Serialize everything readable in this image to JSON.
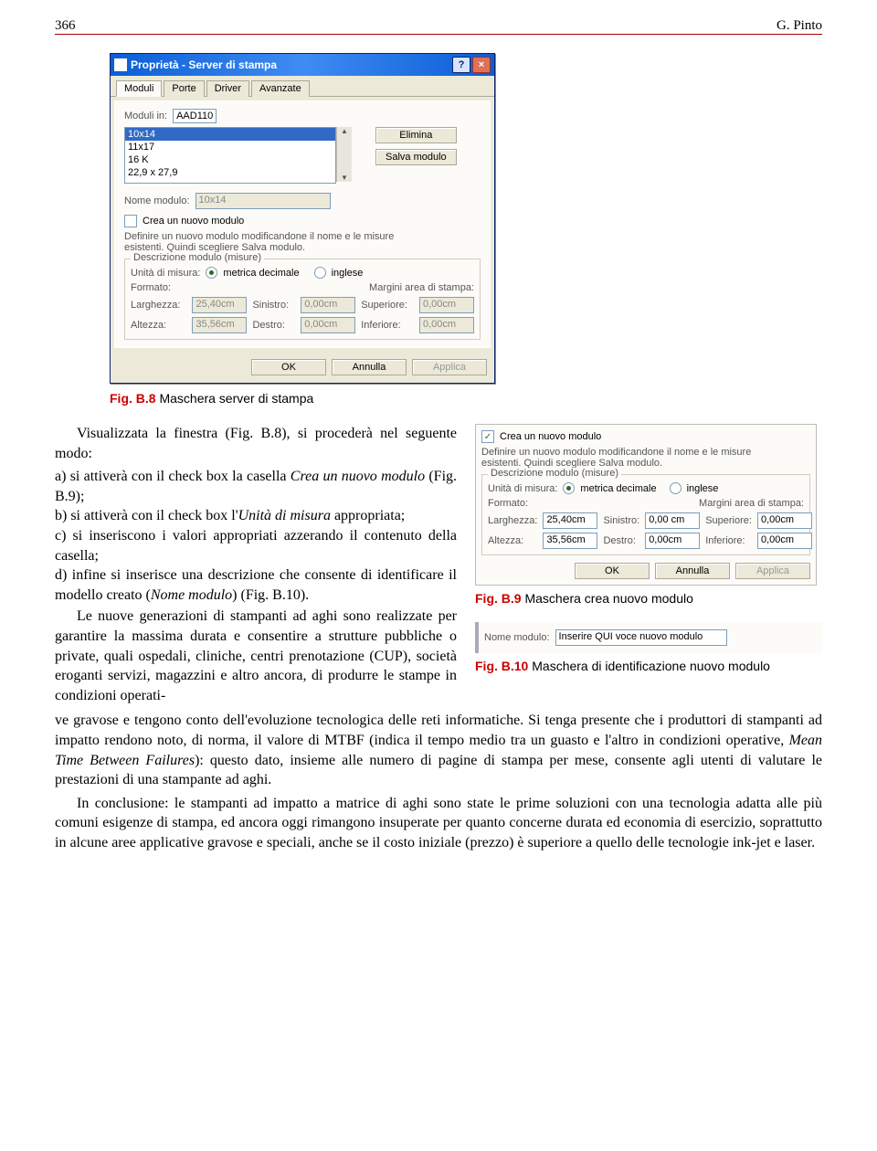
{
  "header": {
    "pagenum": "366",
    "author": "G. Pinto"
  },
  "fig8": {
    "caption_num": "Fig. B.8",
    "caption_text": "Maschera server di stampa",
    "title": "Proprietà - Server di stampa",
    "help_char": "?",
    "close_char": "×",
    "tabs": [
      "Moduli",
      "Porte",
      "Driver",
      "Avanzate"
    ],
    "moduli_in_label": "Moduli in:",
    "moduli_in_value": "AAD110",
    "list": [
      "10x14",
      "11x17",
      "16 K",
      "22,9 x 27,9"
    ],
    "btn_elimina": "Elimina",
    "btn_salva": "Salva modulo",
    "nome_label": "Nome modulo:",
    "nome_value": "10x14",
    "crea_check_label": "Crea un nuovo modulo",
    "help_text": "Definire un nuovo modulo modificandone il nome e le misure esistenti. Quindi scegliere Salva modulo.",
    "group_label": "Descrizione modulo (misure)",
    "unita_label": "Unità di misura:",
    "unita_metrica": "metrica decimale",
    "unita_inglese": "inglese",
    "formato_label": "Formato:",
    "margini_label": "Margini area di stampa:",
    "larghezza_l": "Larghezza:",
    "larghezza_v": "25,40cm",
    "altezza_l": "Altezza:",
    "altezza_v": "35,56cm",
    "sinistro_l": "Sinistro:",
    "sinistro_v": "0,00cm",
    "destro_l": "Destro:",
    "destro_v": "0,00cm",
    "superiore_l": "Superiore:",
    "superiore_v": "0,00cm",
    "inferiore_l": "Inferiore:",
    "inferiore_v": "0,00cm",
    "ok": "OK",
    "annulla": "Annulla",
    "applica": "Applica"
  },
  "fig9": {
    "caption_num": "Fig. B.9",
    "caption_text": "Maschera crea nuovo modulo",
    "crea_check_label": "Crea un nuovo modulo",
    "checked": "✓",
    "help_text": "Definire un nuovo modulo modificandone il nome e le misure esistenti. Quindi scegliere Salva modulo.",
    "group_label": "Descrizione modulo (misure)",
    "unita_label": "Unità di misura:",
    "unita_metrica": "metrica decimale",
    "unita_inglese": "inglese",
    "formato_label": "Formato:",
    "margini_label": "Margini area di stampa:",
    "larghezza_l": "Larghezza:",
    "larghezza_v": "25,40cm",
    "altezza_l": "Altezza:",
    "altezza_v": "35,56cm",
    "sinistro_l": "Sinistro:",
    "sinistro_v": "0,00 cm",
    "destro_l": "Destro:",
    "destro_v": "0,00cm",
    "superiore_l": "Superiore:",
    "superiore_v": "0,00cm",
    "inferiore_l": "Inferiore:",
    "inferiore_v": "0,00cm",
    "ok": "OK",
    "annulla": "Annulla",
    "applica": "Applica"
  },
  "fig10": {
    "caption_num": "Fig. B.10",
    "caption_text": "Maschera di identificazione nuovo modulo",
    "nome_label": "Nome modulo:",
    "nome_value": "Inserire QUI voce nuovo modulo"
  },
  "text": {
    "p1a": "Visualizzata la finestra (Fig. B.8), si procederà nel seguente modo:",
    "p1b": "a) si attiverà con il check box la casella ",
    "p1b_em": "Crea un nuovo modulo",
    "p1b_after": " (Fig. B.9);",
    "p1c": "b) si attiverà con il check box l'",
    "p1c_em": "Unità di misura",
    "p1c_after": " appropriata;",
    "p1d": "c) si inseriscono i valori appropriati azzerando il contenuto della casella;",
    "p1e": "d) infine si inserisce una descrizione che consente di identificare il modello creato (",
    "p1e_em": "Nome modulo",
    "p1e_after": ") (Fig. B.10).",
    "p2": "Le nuove generazioni di stampanti ad aghi sono realizzate per garantire la massima durata e consentire a strutture pubbliche o private, quali ospedali, cliniche, centri prenotazione (CUP), società eroganti servizi, magazzini e altro ancora, di produrre le stampe in condizioni operati-",
    "p3a": "ve gravose e tengono conto dell'evoluzione tecnologica delle reti informatiche. Si tenga presente che i produttori di stampanti ad impatto rendono noto, di norma, il valore di MTBF (indica il tempo medio tra un guasto e l'altro in condizioni operative, ",
    "p3a_em": "Mean Time Between Failures",
    "p3a_after": "): questo dato, insieme alle numero di pagine di stampa per mese, consente agli utenti di valutare le prestazioni di una stampante ad aghi.",
    "p4": "In conclusione: le stampanti ad impatto a matrice di aghi sono state le prime soluzioni con una tecnologia adatta alle più comuni esigenze di stampa, ed ancora oggi rimangono insuperate per quanto concerne durata ed economia di esercizio, soprattutto in alcune aree applicative gravose e speciali, anche se il costo iniziale (prezzo) è superiore a quello delle tecnologie ink-jet e laser."
  }
}
